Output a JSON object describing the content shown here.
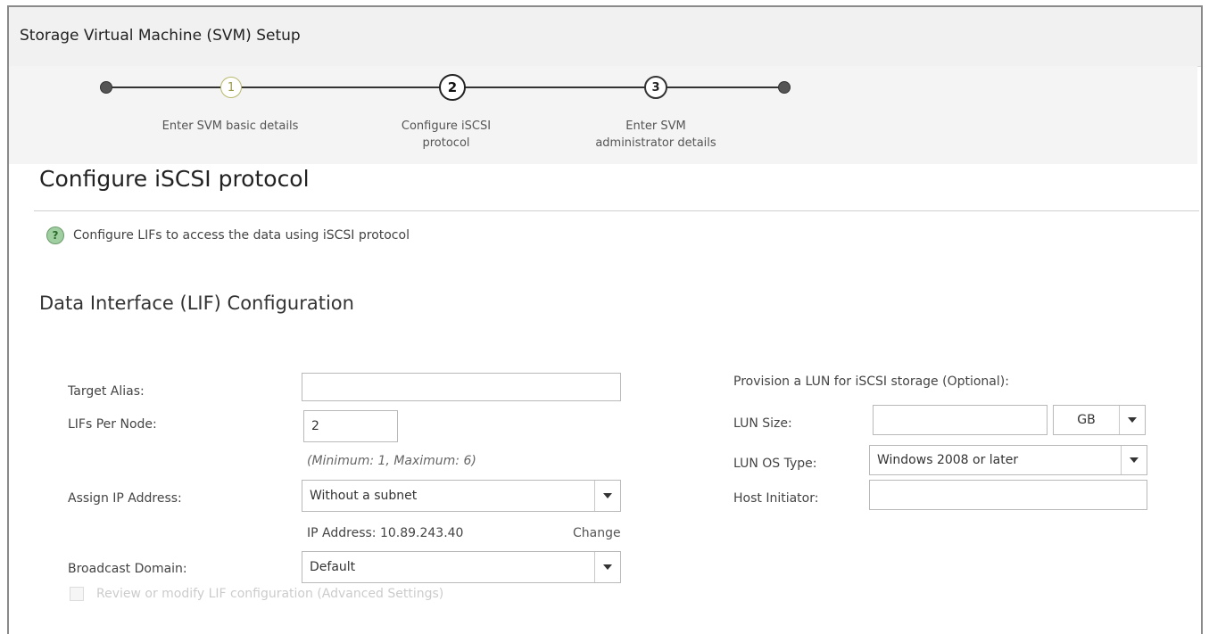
{
  "window": {
    "title": "Storage Virtual Machine (SVM) Setup"
  },
  "wizard": {
    "steps": [
      {
        "number": "1",
        "label_line1": "Enter SVM basic details",
        "label_line2": ""
      },
      {
        "number": "2",
        "label_line1": "Configure iSCSI",
        "label_line2": "protocol"
      },
      {
        "number": "3",
        "label_line1": "Enter SVM",
        "label_line2": "administrator details"
      }
    ]
  },
  "page": {
    "heading": "Configure iSCSI protocol",
    "info": "Configure LIFs to access the data using iSCSI protocol",
    "help_icon": "?"
  },
  "lif_config": {
    "section_title": "Data Interface (LIF) Configuration",
    "target_alias_label": "Target Alias:",
    "target_alias_value": "",
    "lifs_per_node_label": "LIFs Per Node:",
    "lifs_per_node_value": "2",
    "lifs_hint": "(Minimum: 1, Maximum: 6)",
    "assign_ip_label": "Assign IP Address:",
    "assign_ip_value": "Without a subnet",
    "ip_address_text": "IP Address: 10.89.243.40",
    "change_link": "Change",
    "broadcast_label": "Broadcast Domain:",
    "broadcast_value": "Default",
    "advanced_checkbox_label": "Review or modify LIF configuration (Advanced Settings)"
  },
  "lun": {
    "title": "Provision a LUN for iSCSI storage (Optional):",
    "size_label": "LUN Size:",
    "size_value": "",
    "unit_value": "GB",
    "os_type_label": "LUN OS Type:",
    "os_type_value": "Windows 2008 or later",
    "host_initiator_label": "Host Initiator:",
    "host_initiator_value": ""
  }
}
